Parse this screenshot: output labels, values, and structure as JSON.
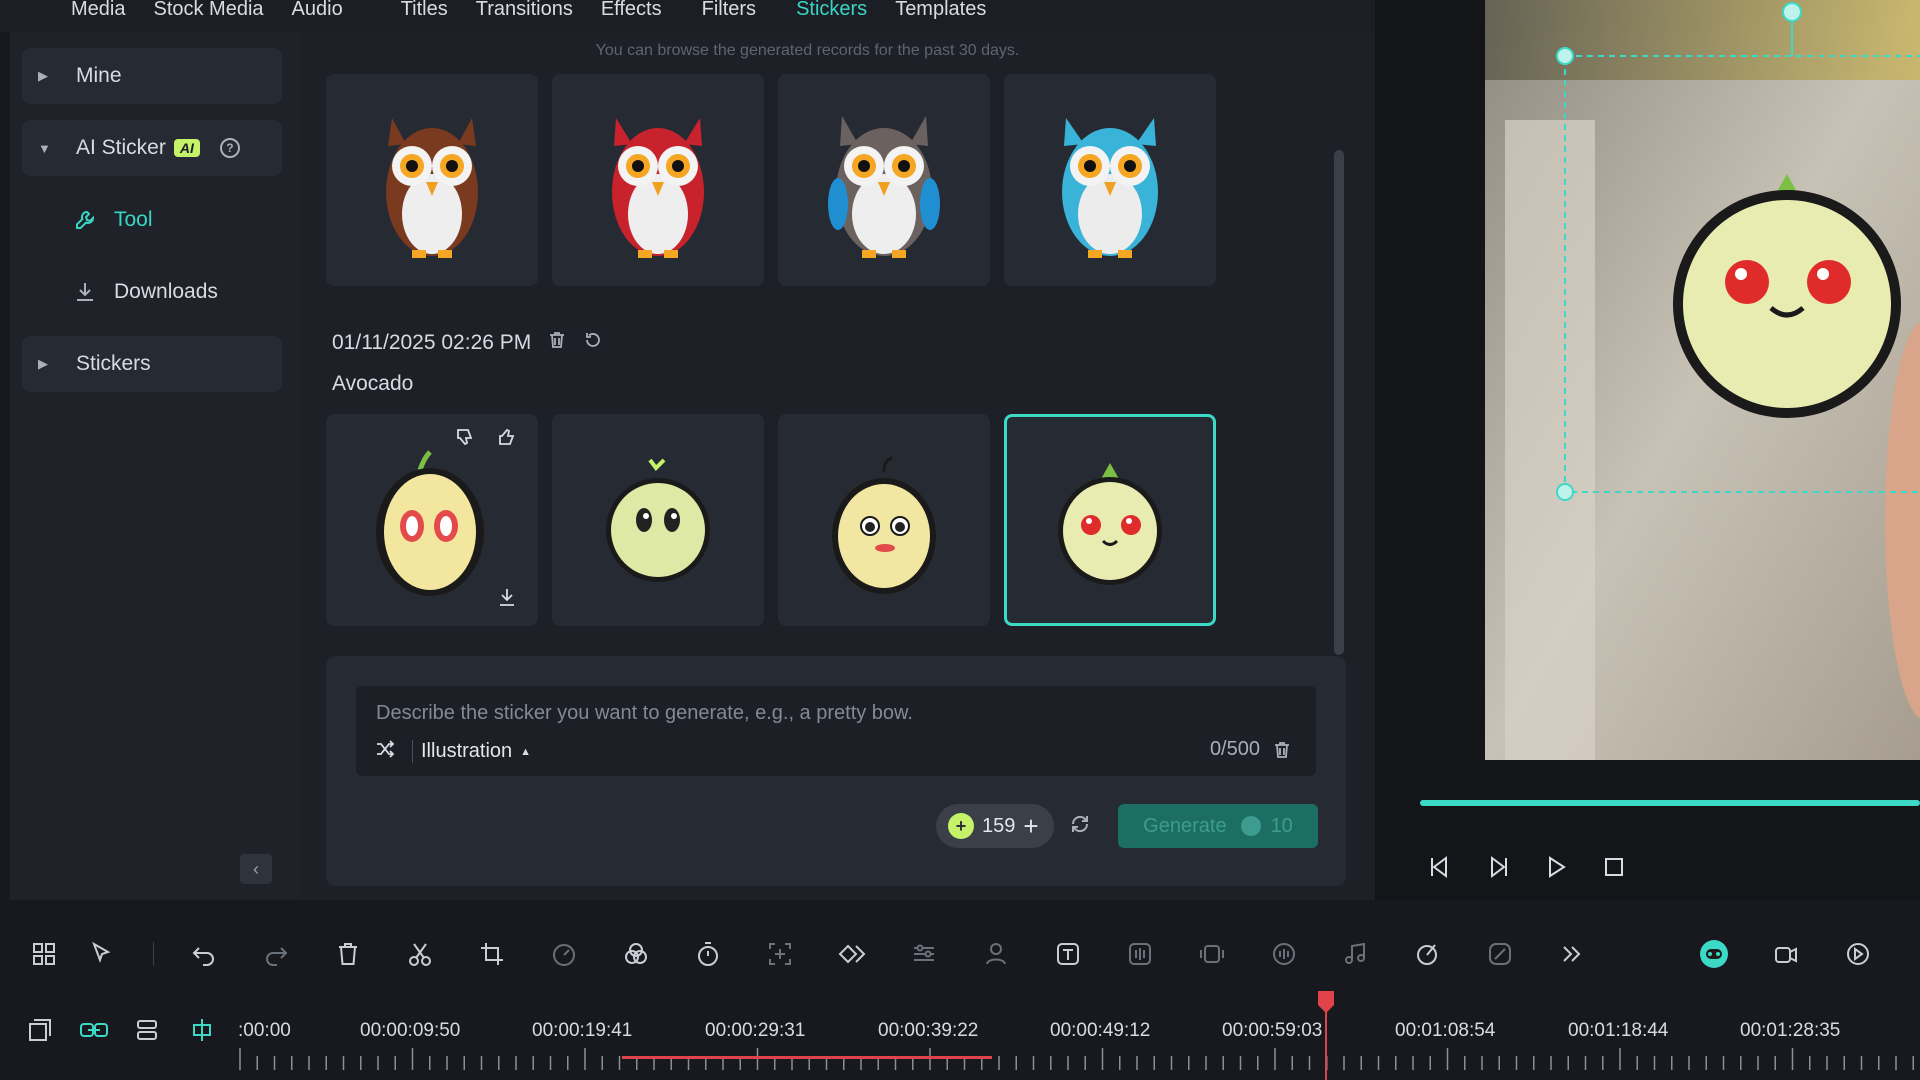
{
  "top_tabs": [
    "Media",
    "Stock Media",
    "Audio",
    "Titles",
    "Transitions",
    "Effects",
    "Filters",
    "Stickers",
    "Templates"
  ],
  "active_tab": "Stickers",
  "sidebar": {
    "mine": "Mine",
    "ai_sticker": "AI Sticker",
    "ai_badge": "AI",
    "help": "?",
    "tool": "Tool",
    "downloads": "Downloads",
    "stickers": "Stickers"
  },
  "notice": "You can browse the generated records for the past 30 days.",
  "record": {
    "date": "01/11/2025 02:26 PM",
    "prompt": "Avocado"
  },
  "generator": {
    "placeholder": "Describe the sticker you want to generate, e.g., a pretty bow.",
    "style": "Illustration",
    "char_count": "0/500",
    "credits": "159",
    "generate_label": "Generate",
    "generate_cost": "10"
  },
  "timeline": {
    "labels": [
      ":00:00",
      "00:00:09:50",
      "00:00:19:41",
      "00:00:29:31",
      "00:00:39:22",
      "00:00:49:12",
      "00:00:59:03",
      "00:01:08:54",
      "00:01:18:44",
      "00:01:28:35"
    ]
  },
  "colors": {
    "accent": "#39d6c6",
    "ai_badge": "#c6f26a",
    "playhead": "#e0434a"
  }
}
